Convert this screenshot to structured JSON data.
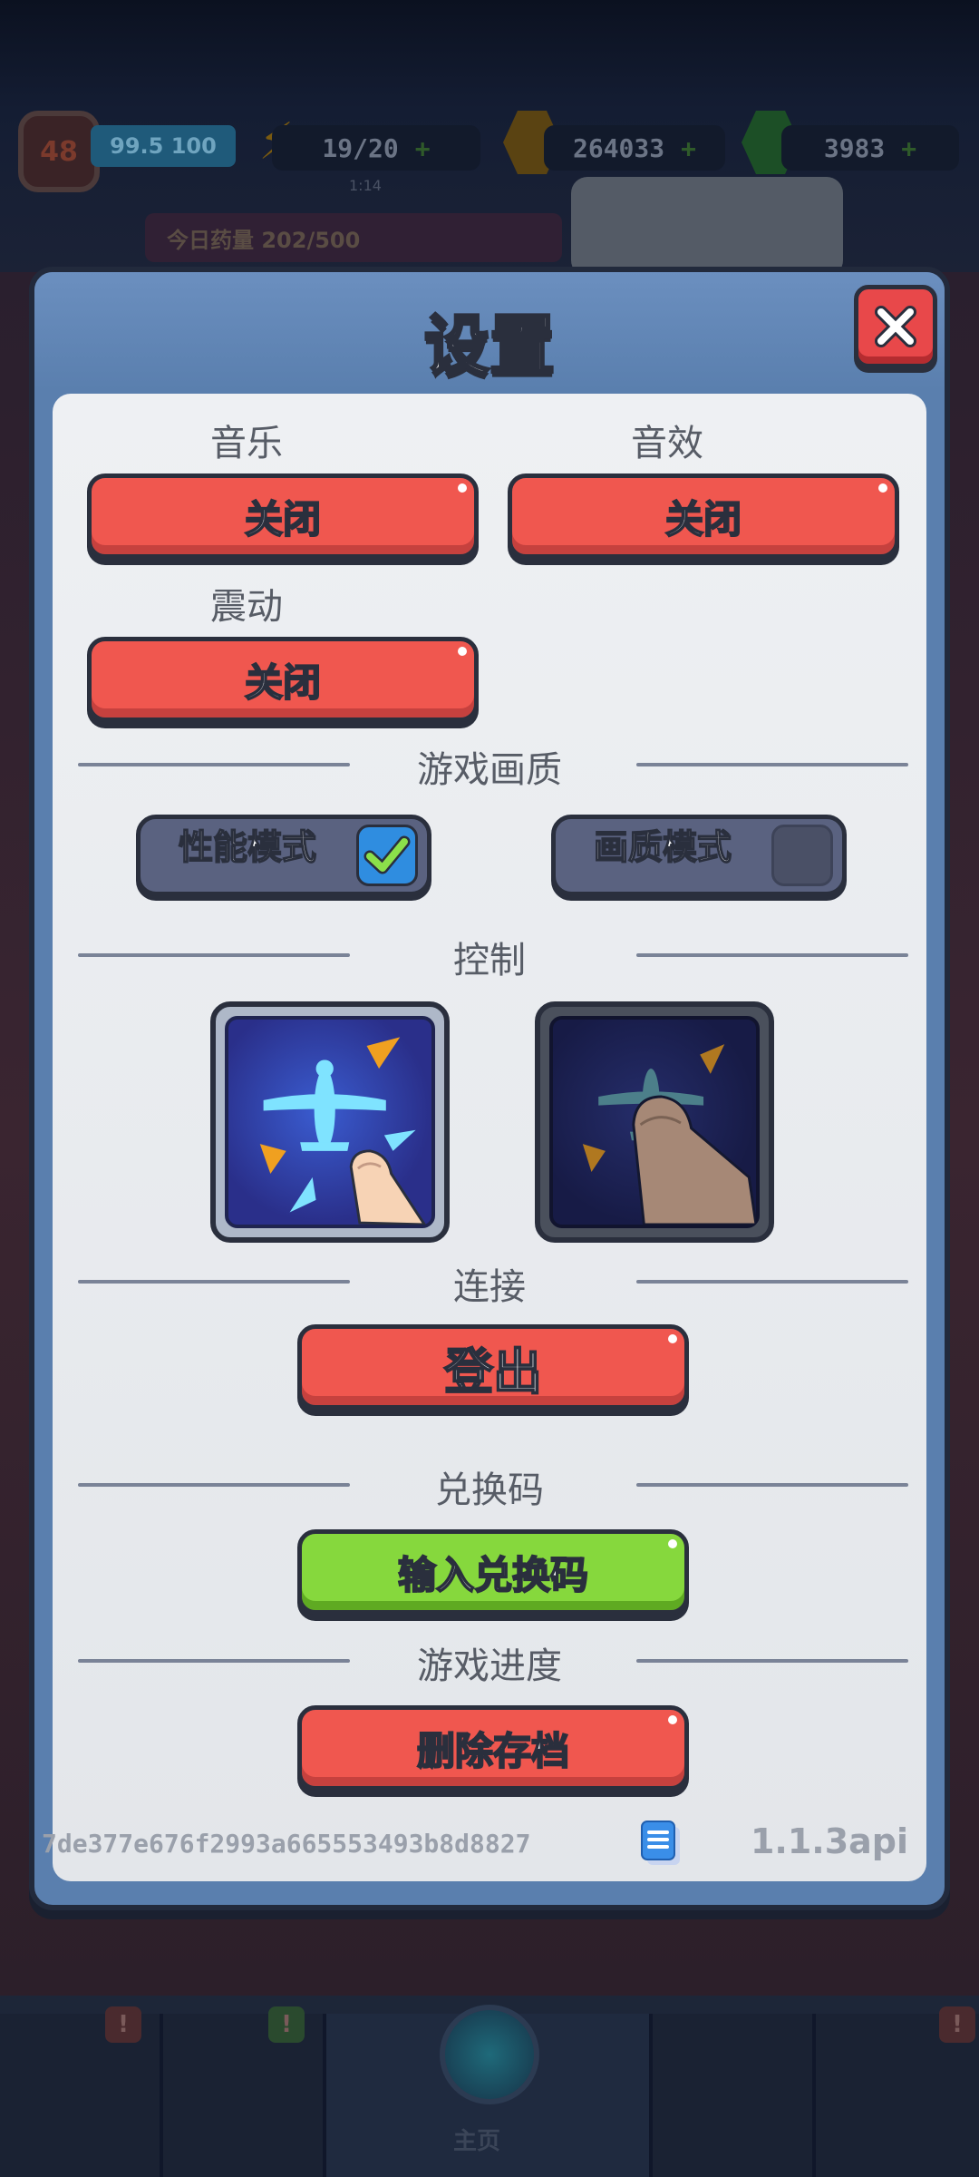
{
  "hud": {
    "level": "48",
    "xp": "99.5 100",
    "energy": "19/20",
    "energy_sub": "1:14",
    "coins": "264033",
    "gems": "3983",
    "banner": "今日药量 202/500"
  },
  "dialog": {
    "title": "设置",
    "sound": {
      "music_label": "音乐",
      "music_value": "关闭",
      "sfx_label": "音效",
      "sfx_value": "关闭",
      "vibration_label": "震动",
      "vibration_value": "关闭"
    },
    "quality": {
      "section_title": "游戏画质",
      "performance_label": "性能模式",
      "performance_checked": true,
      "quality_label": "画质模式",
      "quality_checked": false
    },
    "control": {
      "section_title": "控制",
      "selected_index": 0
    },
    "connect": {
      "section_title": "连接",
      "logout_label": "登出"
    },
    "redeem": {
      "section_title": "兑换码",
      "button_label": "输入兑换码"
    },
    "progress": {
      "section_title": "游戏进度",
      "delete_label": "删除存档"
    },
    "footer": {
      "player_id": "7de377e676f2993a665553493b8d8827",
      "version": "1.1.3api"
    }
  },
  "bottom_nav": {
    "center_label": "主页",
    "badge": "!"
  },
  "colors": {
    "button_red": "#f0574f",
    "button_green": "#86d83d",
    "dialog_blue": "#5a7fae",
    "check_blue": "#2f8de0"
  }
}
